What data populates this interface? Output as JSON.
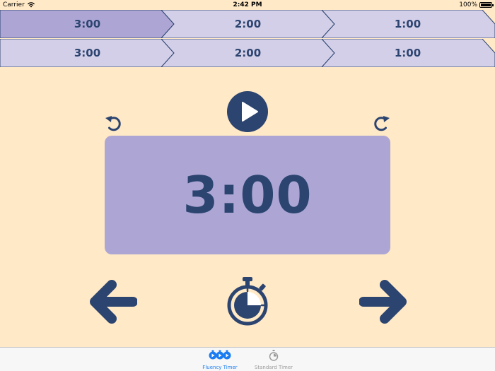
{
  "status_bar": {
    "carrier": "Carrier",
    "time": "2:42 PM",
    "battery": "100%"
  },
  "timer_rows": [
    {
      "segments": [
        "3:00",
        "2:00",
        "1:00"
      ],
      "active_index": 0
    },
    {
      "segments": [
        "3:00",
        "2:00",
        "1:00"
      ],
      "active_index": -1
    }
  ],
  "timer": {
    "display": "3:00"
  },
  "controls": {
    "play_icon": "play-icon",
    "undo_icon": "undo-icon",
    "redo_icon": "redo-icon",
    "prev_icon": "arrow-left-icon",
    "next_icon": "arrow-right-icon",
    "stopwatch_icon": "stopwatch-icon"
  },
  "tabs": [
    {
      "label": "Fluency Timer",
      "icon": "fluency-timer-icon",
      "selected": true
    },
    {
      "label": "Standard Timer",
      "icon": "standard-timer-icon",
      "selected": false
    }
  ],
  "colors": {
    "background": "#ffe9c6",
    "segment_active": "#ada6d4",
    "segment_inactive": "#d3cfe8",
    "primary": "#2c4470",
    "tab_selected": "#1a7cf2",
    "tab_unselected": "#9a9a9a"
  }
}
